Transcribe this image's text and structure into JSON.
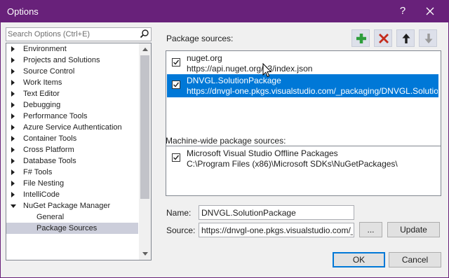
{
  "window": {
    "title": "Options",
    "help_glyph": "?"
  },
  "search": {
    "placeholder": "Search Options (Ctrl+E)"
  },
  "tree": {
    "items": [
      {
        "label": "Environment",
        "expanded": false
      },
      {
        "label": "Projects and Solutions",
        "expanded": false
      },
      {
        "label": "Source Control",
        "expanded": false
      },
      {
        "label": "Work Items",
        "expanded": false
      },
      {
        "label": "Text Editor",
        "expanded": false
      },
      {
        "label": "Debugging",
        "expanded": false
      },
      {
        "label": "Performance Tools",
        "expanded": false
      },
      {
        "label": "Azure Service Authentication",
        "expanded": false
      },
      {
        "label": "Container Tools",
        "expanded": false
      },
      {
        "label": "Cross Platform",
        "expanded": false
      },
      {
        "label": "Database Tools",
        "expanded": false
      },
      {
        "label": "F# Tools",
        "expanded": false
      },
      {
        "label": "File Nesting",
        "expanded": false
      },
      {
        "label": "IntelliCode",
        "expanded": false
      },
      {
        "label": "NuGet Package Manager",
        "expanded": true
      },
      {
        "label": "General",
        "child": true
      },
      {
        "label": "Package Sources",
        "child": true,
        "selected": true
      }
    ]
  },
  "package_sources": {
    "label": "Package sources:",
    "items": [
      {
        "name": "nuget.org",
        "source": "https://api.nuget.org/v3/index.json",
        "checked": true,
        "selected": false
      },
      {
        "name": "DNVGL.SolutionPackage",
        "source": "https://dnvgl-one.pkgs.visualstudio.com/_packaging/DNVGL.SolutionP...",
        "checked": true,
        "selected": true
      }
    ]
  },
  "toolbar": {
    "add": "add-icon",
    "remove": "remove-icon",
    "up": "arrow-up-icon",
    "down": "arrow-down-icon"
  },
  "machine_sources": {
    "label": "Machine-wide package sources:",
    "items": [
      {
        "name": "Microsoft Visual Studio Offline Packages",
        "source": "C:\\Program Files (x86)\\Microsoft SDKs\\NuGetPackages\\",
        "checked": true
      }
    ]
  },
  "form": {
    "name_label": "Name:",
    "name_value": "DNVGL.SolutionPackage",
    "source_label": "Source:",
    "source_value": "https://dnvgl-one.pkgs.visualstudio.com/_pa",
    "browse_label": "...",
    "update_label": "Update"
  },
  "footer": {
    "ok_label": "OK",
    "cancel_label": "Cancel"
  },
  "colors": {
    "titlebar": "#68217a",
    "selection": "#0078d7",
    "add": "#2e9e3c",
    "remove": "#c42b1c"
  }
}
